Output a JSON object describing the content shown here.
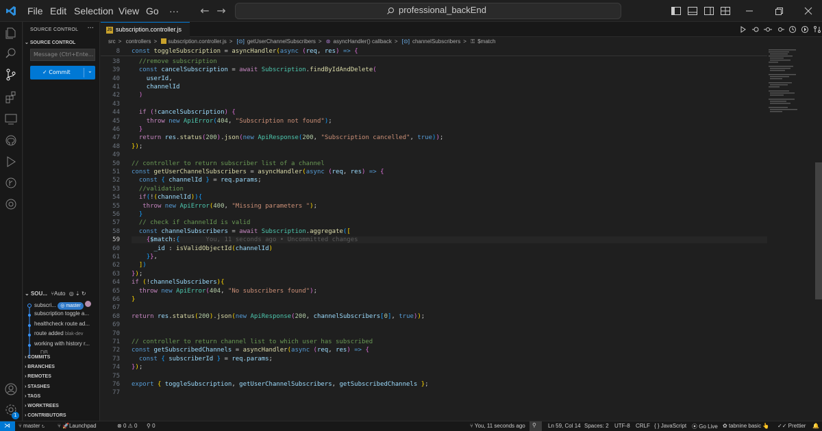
{
  "title_bar": {
    "menus": [
      "File",
      "Edit",
      "Selection",
      "View",
      "Go",
      "···"
    ],
    "search_text": "professional_backEnd"
  },
  "sidebar": {
    "title": "SOURCE CONTROL",
    "more": "···",
    "section": "SOURCE CONTROL",
    "message_placeholder": "Message (Ctrl+Ente...",
    "commit_label": "✓ Commit",
    "graph_header": "SOU...",
    "graph_auto": "Auto",
    "graph": [
      {
        "text": "subscri...",
        "branch": "master"
      },
      {
        "text": "subscription toggle a..."
      },
      {
        "text": "healthcheck route ad..."
      },
      {
        "text": "route added",
        "author": "blak-dev"
      },
      {
        "text": "working with history r..."
      },
      {
        "text": "... DB ..."
      }
    ],
    "sections": [
      "COMMITS",
      "BRANCHES",
      "REMOTES",
      "STASHES",
      "TAGS",
      "WORKTREES",
      "CONTRIBUTORS"
    ]
  },
  "editor": {
    "tab": "subscription.controller.js",
    "breadcrumb": [
      "src",
      ">",
      "controllers",
      ">",
      "subscription.controller.js",
      ">",
      "getUserChannelSubscribers",
      ">",
      "asyncHandler() callback",
      ">",
      "channelSubscribers",
      ">",
      "$match"
    ],
    "sticky": {
      "num": "8",
      "text": "const toggleSubscription = asyncHandler(async (req, res) => {"
    },
    "blame": "You, 11 seconds ago • Uncommitted changes",
    "lines": [
      "38",
      "39",
      "40",
      "41",
      "42",
      "43",
      "44",
      "45",
      "46",
      "47",
      "48",
      "49",
      "50",
      "51",
      "52",
      "53",
      "54",
      "55",
      "56",
      "57",
      "58",
      "59",
      "60",
      "61",
      "62",
      "63",
      "64",
      "65",
      "66",
      "67",
      "68",
      "69",
      "70",
      "71",
      "72",
      "73",
      "74",
      "75",
      "76",
      "77"
    ]
  },
  "status": {
    "branch": "master",
    "launchpad": "Launchpad",
    "errors": "0",
    "warnings": "0",
    "ports": "0",
    "blame": "You, 11 seconds ago",
    "position": "Ln 59, Col 14",
    "spaces": "Spaces: 2",
    "encoding": "UTF-8",
    "eol": "CRLF",
    "language": "JavaScript",
    "golive": "Go Live",
    "tabnine": "tabnine basic",
    "prettier": "Prettier"
  },
  "colors": {
    "accent": "#0078d4",
    "bg": "#1f1f1f",
    "sidebar": "#181818"
  }
}
